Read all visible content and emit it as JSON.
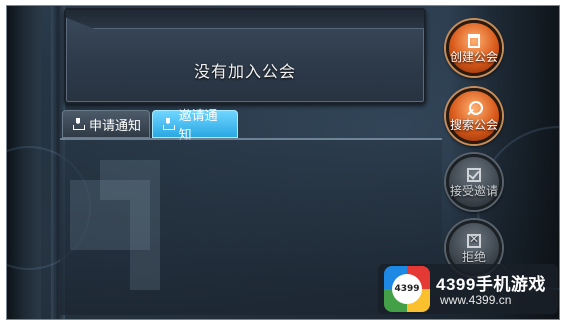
{
  "banner": {
    "status_text": "没有加入公会"
  },
  "tabs": [
    {
      "label": "申请通知",
      "icon": "inbox-download-icon",
      "active": false
    },
    {
      "label": "邀请通知",
      "icon": "inbox-download-icon",
      "active": true
    }
  ],
  "actions": [
    {
      "label": "创建公会",
      "icon": "tower-icon",
      "enabled": true
    },
    {
      "label": "搜索公会",
      "icon": "search-icon",
      "enabled": true
    },
    {
      "label": "接受邀请",
      "icon": "checkbox-icon",
      "enabled": false
    },
    {
      "label": "拒绝",
      "icon": "close-box-icon",
      "enabled": false
    }
  ],
  "watermark": {
    "logo_text": "4399",
    "title": "4399手机游戏",
    "url": "www.4399.cn"
  },
  "colors": {
    "active_tab": "#2aa7e4",
    "action_button": "#d8591a",
    "disabled_button": "#3e464e"
  }
}
